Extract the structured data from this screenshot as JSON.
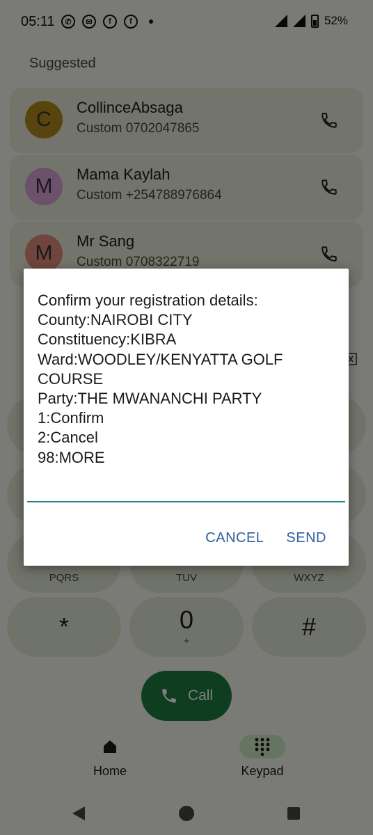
{
  "status_bar": {
    "time": "05:11",
    "notifications": [
      "whatsapp-icon",
      "chat-icon",
      "facebook-icon",
      "facebook-icon"
    ],
    "battery_percent": "52%"
  },
  "suggested": {
    "title": "Suggested",
    "contacts": [
      {
        "initial": "C",
        "name": "CollinceAbsaga",
        "number": "Custom 0702047865",
        "avatar_color": "#b08a1c"
      },
      {
        "initial": "M",
        "name": "Mama Kaylah",
        "number": "Custom +254788976864",
        "avatar_color": "#d7a3d6"
      },
      {
        "initial": "M",
        "name": "Mr Sang",
        "number": "Custom 0708322719",
        "avatar_color": "#e08a7a"
      }
    ]
  },
  "keypad": {
    "row4": [
      {
        "letters": "PQRS"
      },
      {
        "letters": "TUV"
      },
      {
        "letters": "WXYZ"
      }
    ],
    "row5": [
      {
        "digit": "*",
        "letters": ""
      },
      {
        "digit": "0",
        "letters": "+"
      },
      {
        "digit": "#",
        "letters": ""
      }
    ],
    "call_label": "Call"
  },
  "bottom_nav": {
    "home_label": "Home",
    "keypad_label": "Keypad"
  },
  "dialog": {
    "lines": [
      "Confirm your registration details:",
      "County:NAIROBI CITY",
      "Constituency:KIBRA",
      "Ward:WOODLEY/KENYATTA GOLF",
      "COURSE",
      "Party:THE MWANANCHI PARTY",
      "1:Confirm",
      "2:Cancel",
      "98:MORE"
    ],
    "input_value": "",
    "cancel_label": "CANCEL",
    "send_label": "SEND"
  },
  "colors": {
    "accent": "#2e5e9c",
    "input_underline": "#1f7f86",
    "call_button": "#1d7a3f"
  }
}
